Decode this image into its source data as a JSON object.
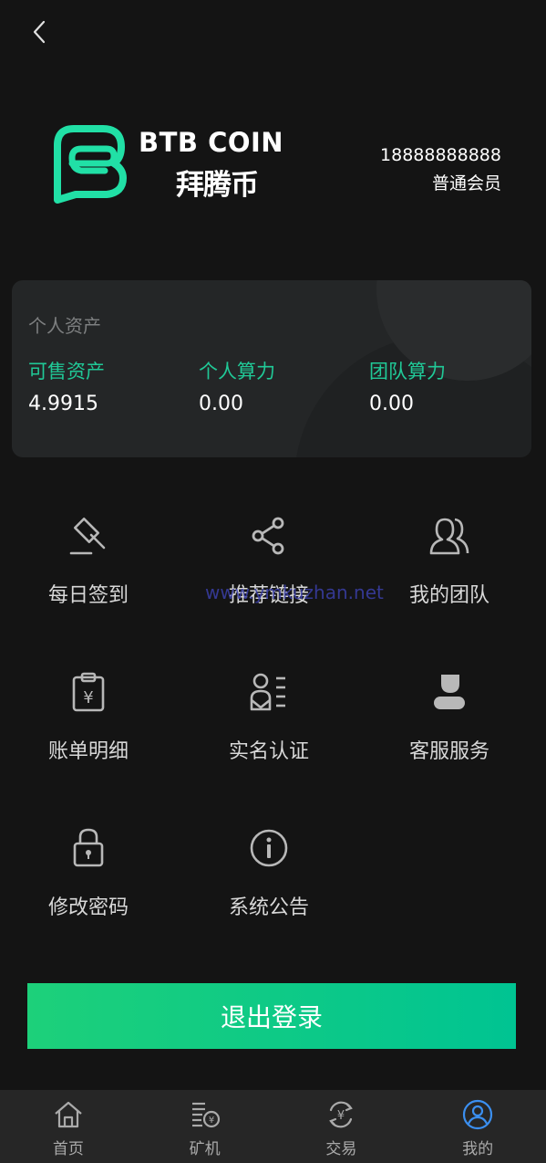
{
  "header": {
    "back_icon": "chevron-left-icon"
  },
  "brand": {
    "name_en": "BTB COIN",
    "name_cn": "拜腾币",
    "logo_icon": "speech-bubble-logo-icon",
    "logo_color": "#21e0a6"
  },
  "user": {
    "phone": "18888888888",
    "level": "普通会员"
  },
  "assets": {
    "title": "个人资产",
    "items": [
      {
        "label": "可售资产",
        "value": "4.9915"
      },
      {
        "label": "个人算力",
        "value": "0.00"
      },
      {
        "label": "团队算力",
        "value": "0.00"
      }
    ],
    "label_color": "#20c997"
  },
  "menu": [
    {
      "label": "每日签到",
      "icon": "gavel-icon"
    },
    {
      "label": "推荐链接",
      "icon": "share-icon"
    },
    {
      "label": "我的团队",
      "icon": "team-icon"
    },
    {
      "label": "账单明细",
      "icon": "bill-clipboard-icon"
    },
    {
      "label": "实名认证",
      "icon": "id-card-icon"
    },
    {
      "label": "客服服务",
      "icon": "customer-service-icon"
    },
    {
      "label": "修改密码",
      "icon": "lock-icon"
    },
    {
      "label": "系统公告",
      "icon": "info-icon"
    }
  ],
  "watermark": "www.ymkuzhan.net",
  "logout": {
    "label": "退出登录",
    "color_start": "#1dd07a",
    "color_end": "#00c492"
  },
  "tabbar": {
    "items": [
      {
        "label": "首页",
        "icon": "home-icon"
      },
      {
        "label": "矿机",
        "icon": "mining-machine-icon"
      },
      {
        "label": "交易",
        "icon": "exchange-icon"
      },
      {
        "label": "我的",
        "icon": "profile-icon",
        "active": true
      }
    ],
    "active_color": "#3b8ff0"
  }
}
